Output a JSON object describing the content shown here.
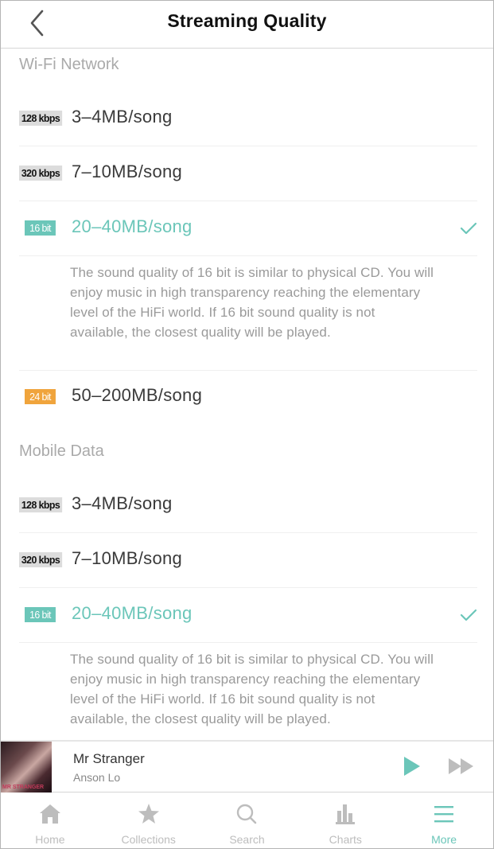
{
  "header": {
    "title": "Streaming Quality",
    "back_icon": "chevron-left-icon"
  },
  "colors": {
    "accent": "#6bc6b9",
    "badge_24bit": "#f0a43c",
    "badge_kbps_bg": "#dcdcdc",
    "section_label": "#aaaaaa",
    "description_text": "#9a9a9a"
  },
  "sections": [
    {
      "label": "Wi-Fi Network",
      "options": [
        {
          "badge": "128 kbps",
          "size": "3–4MB/song",
          "selected": false
        },
        {
          "badge": "320 kbps",
          "size": "7–10MB/song",
          "selected": false
        },
        {
          "badge": "16 bit",
          "size": "20–40MB/song",
          "selected": true
        },
        {
          "badge": "24 bit",
          "size": "50–200MB/song",
          "selected": false
        }
      ],
      "description": "The sound quality of 16 bit is similar to physical CD. You will enjoy music in high transparency reaching the elementary level of the HiFi world. If 16 bit sound quality is not available, the closest quality will be played."
    },
    {
      "label": "Mobile Data",
      "options": [
        {
          "badge": "128 kbps",
          "size": "3–4MB/song",
          "selected": false
        },
        {
          "badge": "320 kbps",
          "size": "7–10MB/song",
          "selected": false
        },
        {
          "badge": "16 bit",
          "size": "20–40MB/song",
          "selected": true
        }
      ],
      "description": "The sound quality of 16 bit is similar to physical CD. You will enjoy music in high transparency reaching the elementary level of the HiFi world. If 16 bit sound quality is not available, the closest quality will be played."
    }
  ],
  "player": {
    "title": "Mr Stranger",
    "artist": "Anson Lo",
    "album_art_text": "MR STRANGER",
    "play_icon": "play-icon",
    "next_icon": "fast-forward-icon"
  },
  "tabbar": {
    "items": [
      {
        "label": "Home",
        "icon": "home-icon",
        "active": false
      },
      {
        "label": "Collections",
        "icon": "star-icon",
        "active": false
      },
      {
        "label": "Search",
        "icon": "search-icon",
        "active": false
      },
      {
        "label": "Charts",
        "icon": "bar-chart-icon",
        "active": false
      },
      {
        "label": "More",
        "icon": "menu-icon",
        "active": true
      }
    ]
  }
}
